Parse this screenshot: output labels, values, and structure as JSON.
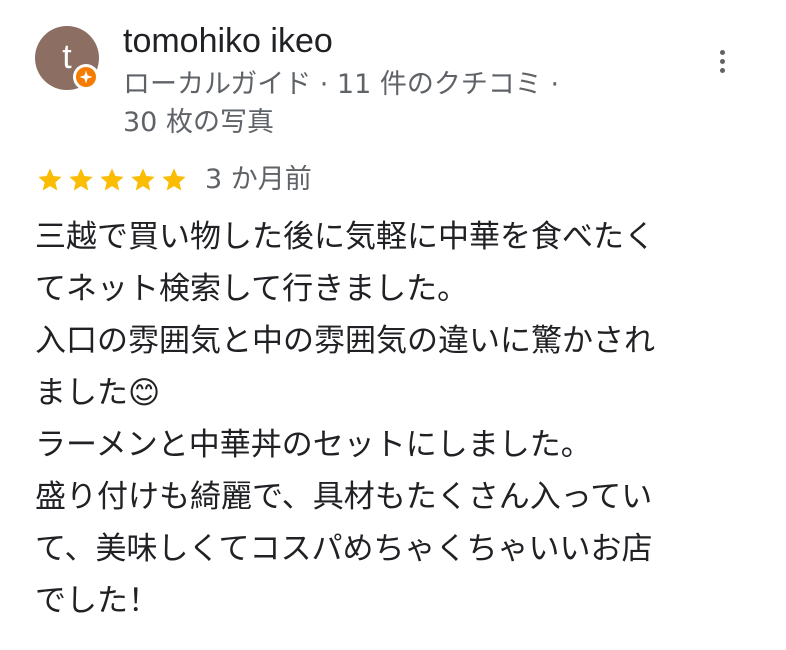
{
  "reviewer": {
    "avatar_initial": "t",
    "avatar_color": "#8d6e63",
    "name": "tomohiko ikeo",
    "meta_line1": "ローカルガイド · 11 件のクチコミ ·",
    "meta_line2": "30 枚の写真",
    "badge_icon": "local-guide-star-icon"
  },
  "review": {
    "rating": 5,
    "rating_max": 5,
    "star_color": "#fbbc04",
    "date": "3 か月前",
    "lines": [
      "三越で買い物した後に気軽に中華を食べたく",
      "てネット検索して行きました。",
      "入口の雰囲気と中の雰囲気の違いに驚かされ",
      "ました😊",
      "ラーメンと中華丼のセットにしました。",
      "盛り付けも綺麗で、具材もたくさん入ってい",
      "て、美味しくてコスパめちゃくちゃいいお店",
      "でした！"
    ]
  },
  "menu": {
    "icon": "more-vert-icon"
  }
}
